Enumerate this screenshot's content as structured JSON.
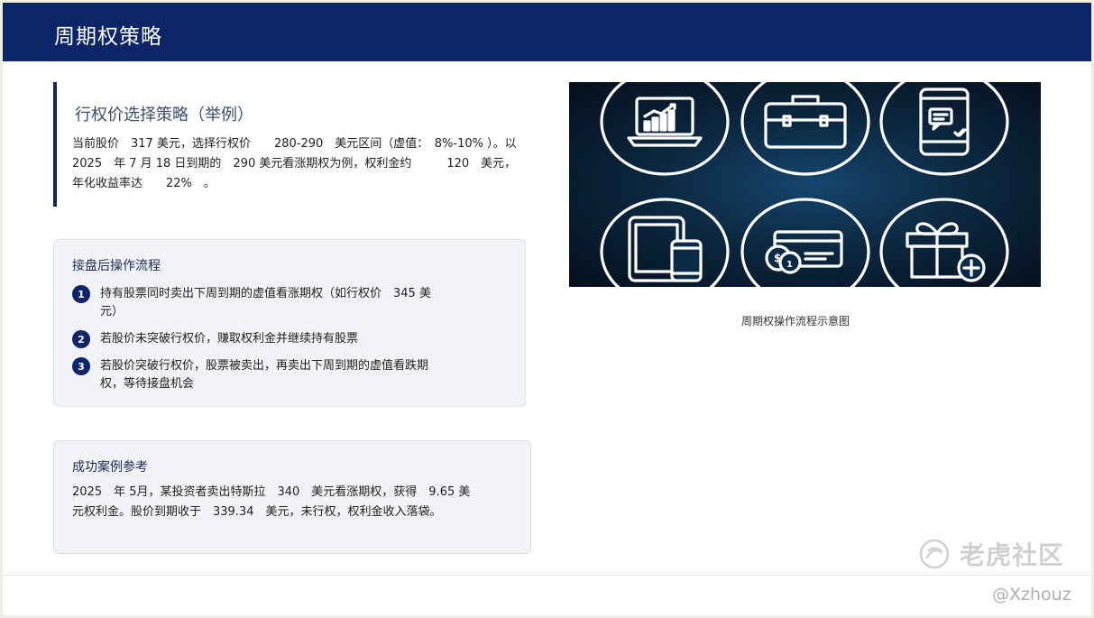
{
  "header": {
    "title": "周期权策略"
  },
  "strategy": {
    "title": "行权价选择策略（举例）",
    "body": "当前股价　317 美元，选择行权价　　280-290　美元区间（虚值：　8%-10% ）。以 2025　年 7 月 18 日到期的　290 美元看涨期权为例，权利金约　　　120　美元，年化收益率达　　22%　。"
  },
  "operations": {
    "title": "接盘后操作流程",
    "steps": [
      {
        "num": "1",
        "text": "持有股票同时卖出下周到期的虚值看涨期权（如行权价　345 美元）"
      },
      {
        "num": "2",
        "text": "若股价未突破行权价，赚取权利金并继续持有股票"
      },
      {
        "num": "3",
        "text": "若股价突破行权价，股票被卖出，再卖出下周到期的虚值看跌期权，等待接盘机会"
      }
    ]
  },
  "case": {
    "title": "成功案例参考",
    "body": "2025　年 5月，某投资者卖出特斯拉　340　美元看涨期权，获得　9.65 美元权利金。股价到期收于　339.34　美元，未行权，权利金收入落袋。"
  },
  "image": {
    "caption": "周期权操作流程示意图",
    "icons": [
      "laptop-chart-icon",
      "briefcase-icon",
      "phone-chat-icon",
      "devices-icon",
      "money-card-icon",
      "gift-plus-icon"
    ]
  },
  "watermark": {
    "brand": "老虎社区",
    "handle": "@Xzhouz"
  },
  "colors": {
    "header": "#0c2468",
    "card": "#f2f3f7",
    "accent": "#0c2468"
  }
}
